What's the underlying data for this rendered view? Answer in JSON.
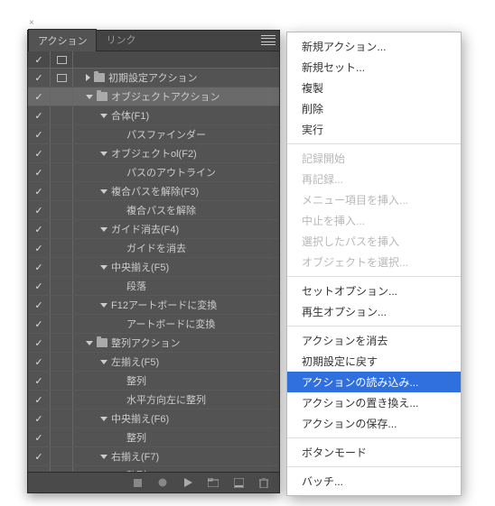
{
  "panel": {
    "tabs": [
      {
        "label": "アクション",
        "active": true
      },
      {
        "label": "リンク",
        "active": false
      }
    ]
  },
  "tree": [
    {
      "indent": 0,
      "checked": true,
      "box": true,
      "arrow": "right",
      "folder": true,
      "label": "初期設定アクション"
    },
    {
      "indent": 0,
      "checked": true,
      "arrow": "down",
      "folder": true,
      "label": "オブジェクトアクション",
      "selected": true
    },
    {
      "indent": 1,
      "checked": true,
      "arrow": "down",
      "label": "合体(F1)"
    },
    {
      "indent": 2,
      "checked": true,
      "label": "パスファインダー"
    },
    {
      "indent": 1,
      "checked": true,
      "arrow": "down",
      "label": "オブジェクトol(F2)"
    },
    {
      "indent": 2,
      "checked": true,
      "label": "パスのアウトライン"
    },
    {
      "indent": 1,
      "checked": true,
      "arrow": "down",
      "label": "複合パスを解除(F3)"
    },
    {
      "indent": 2,
      "checked": true,
      "label": "複合パスを解除"
    },
    {
      "indent": 1,
      "checked": true,
      "arrow": "down",
      "label": "ガイド消去(F4)"
    },
    {
      "indent": 2,
      "checked": true,
      "label": "ガイドを消去"
    },
    {
      "indent": 1,
      "checked": true,
      "arrow": "down",
      "label": "中央揃え(F5)"
    },
    {
      "indent": 2,
      "checked": true,
      "label": "段落"
    },
    {
      "indent": 1,
      "checked": true,
      "arrow": "down",
      "label": "F12アートボードに変換"
    },
    {
      "indent": 2,
      "checked": true,
      "label": "アートボードに変換"
    },
    {
      "indent": 0,
      "checked": true,
      "arrow": "down",
      "folder": true,
      "label": "整列アクション"
    },
    {
      "indent": 1,
      "checked": true,
      "arrow": "down",
      "label": "左揃え(F5)"
    },
    {
      "indent": 2,
      "checked": true,
      "label": "整列"
    },
    {
      "indent": 2,
      "checked": true,
      "label": "水平方向左に整列"
    },
    {
      "indent": 1,
      "checked": true,
      "arrow": "down",
      "label": "中央揃え(F6)"
    },
    {
      "indent": 2,
      "checked": true,
      "label": "整列"
    },
    {
      "indent": 1,
      "checked": true,
      "arrow": "down",
      "label": "右揃え(F7)"
    },
    {
      "indent": 2,
      "checked": true,
      "label": "整列"
    }
  ],
  "menu": [
    {
      "label": "新規アクション..."
    },
    {
      "label": "新規セット..."
    },
    {
      "label": "複製"
    },
    {
      "label": "削除"
    },
    {
      "label": "実行"
    },
    {
      "sep": true
    },
    {
      "label": "記録開始",
      "disabled": true
    },
    {
      "label": "再記録...",
      "disabled": true
    },
    {
      "label": "メニュー項目を挿入...",
      "disabled": true
    },
    {
      "label": "中止を挿入...",
      "disabled": true
    },
    {
      "label": "選択したパスを挿入",
      "disabled": true
    },
    {
      "label": "オブジェクトを選択...",
      "disabled": true
    },
    {
      "sep": true
    },
    {
      "label": "セットオプション..."
    },
    {
      "label": "再生オプション..."
    },
    {
      "sep": true
    },
    {
      "label": "アクションを消去"
    },
    {
      "label": "初期設定に戻す"
    },
    {
      "label": "アクションの読み込み...",
      "highlight": true
    },
    {
      "label": "アクションの置き換え..."
    },
    {
      "label": "アクションの保存..."
    },
    {
      "sep": true
    },
    {
      "label": "ボタンモード"
    },
    {
      "sep": true
    },
    {
      "label": "バッチ..."
    }
  ]
}
